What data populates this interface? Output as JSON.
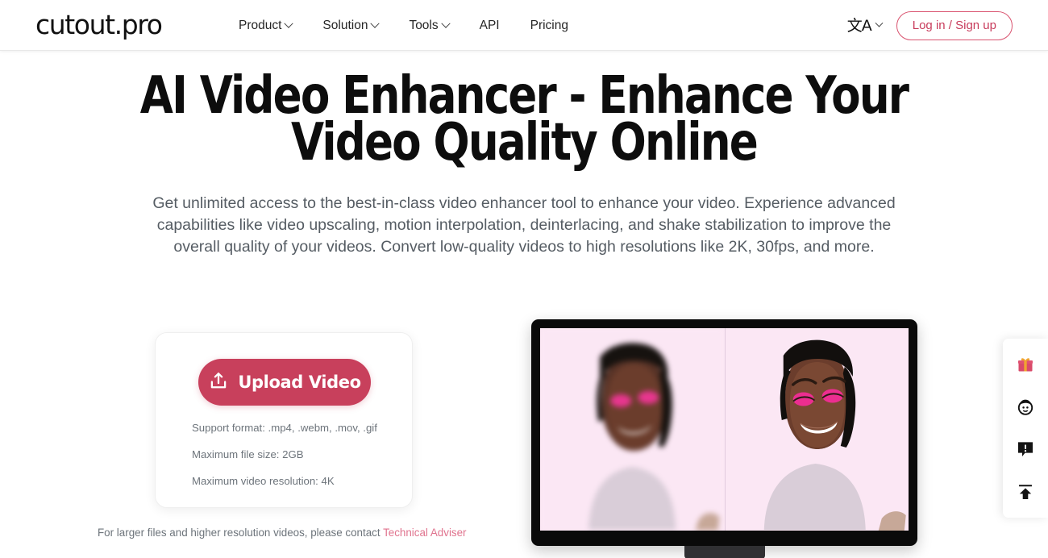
{
  "brand": {
    "logo_text": "cutout.pro",
    "accent_color": "#c8405c",
    "link_color": "#e0738e"
  },
  "header": {
    "nav": [
      {
        "label": "Product",
        "has_dropdown": true
      },
      {
        "label": "Solution",
        "has_dropdown": true
      },
      {
        "label": "Tools",
        "has_dropdown": true
      },
      {
        "label": "API",
        "has_dropdown": false
      },
      {
        "label": "Pricing",
        "has_dropdown": false
      }
    ],
    "language": {
      "icon": "translate-icon",
      "glyph": "文A"
    },
    "login_label": "Log in / Sign up"
  },
  "hero": {
    "title": "AI Video Enhancer - Enhance Your Video Quality Online",
    "subtitle": "Get unlimited access to the best-in-class video enhancer tool to enhance your video. Experience advanced capabilities like video upscaling, motion interpolation, deinterlacing, and shake stabilization to improve the overall quality of your videos. Convert low-quality videos to high resolutions like 2K, 30fps, and more."
  },
  "upload_card": {
    "button_label": "Upload Video",
    "button_icon": "upload-icon",
    "notes": [
      "Support format: .mp4, .webm, .mov, .gif",
      "Maximum file size: 2GB",
      "Maximum video resolution: 4K"
    ]
  },
  "contact": {
    "text": "For larger files and higher resolution videos, please contact ",
    "link_label": "Technical Adviser"
  },
  "preview": {
    "alt": "Before and after video enhancement comparison",
    "left_pane": "blurry original video frame",
    "right_pane": "enhanced sharp video frame",
    "background_color": "#fbe7f4"
  },
  "floatbar": {
    "items": [
      {
        "icon": "gift-icon"
      },
      {
        "icon": "avatar-face-icon"
      },
      {
        "icon": "feedback-icon"
      },
      {
        "icon": "back-to-top-icon"
      }
    ]
  }
}
